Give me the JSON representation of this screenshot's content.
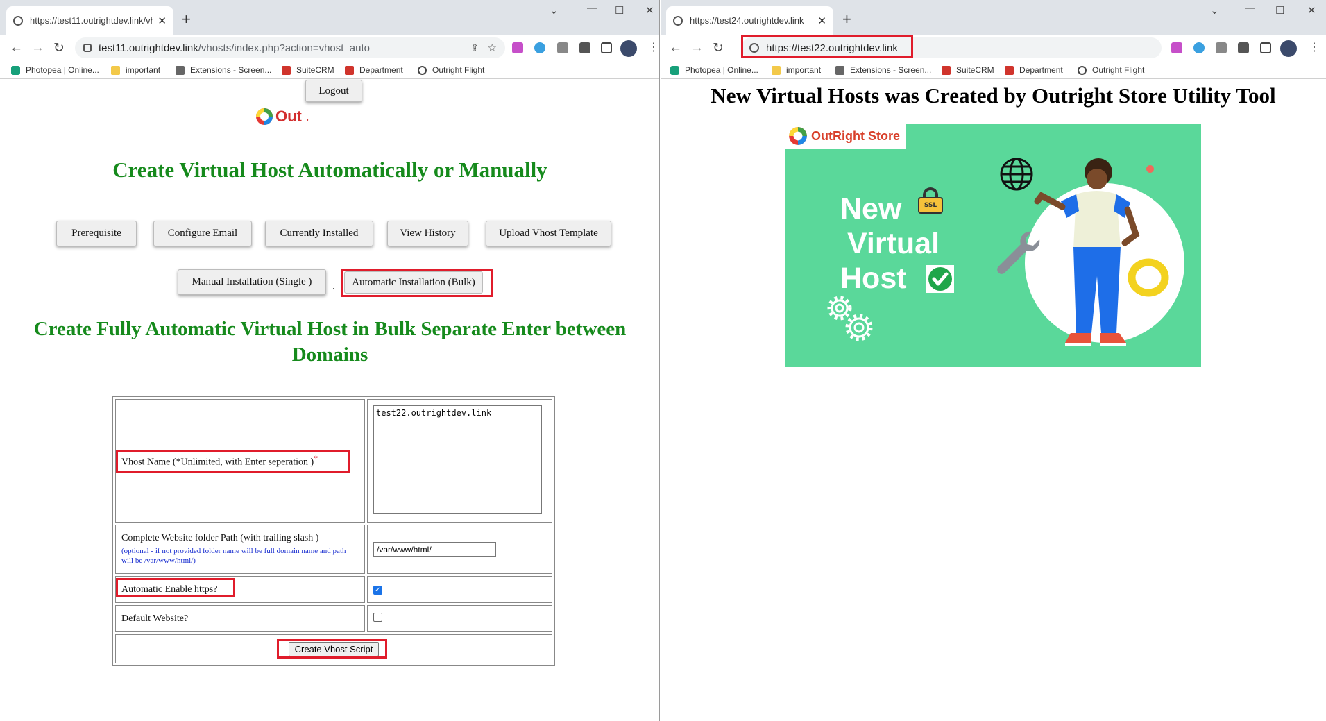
{
  "left": {
    "tab_title": "https://test11.outrightdev.link/vh",
    "url_host": "test11.outrightdev.link",
    "url_path": "/vhosts/index.php?action=vhost_auto",
    "logout": "Logout",
    "logo_text": "Out",
    "logo_dot": ".",
    "heading": "Create Virtual Host Automatically or Manually",
    "nav_buttons": [
      "Prerequisite",
      "Configure Email",
      "Currently Installed",
      "View History",
      "Upload Vhost Template"
    ],
    "manual_button": "Manual Installation (Single )",
    "sep_dot": ".",
    "auto_button": "Automatic Installation (Bulk)",
    "subheading": "Create Fully Automatic Virtual Host in Bulk Separate Enter between Domains",
    "form": {
      "vhost_label": "Vhost Name (*Unlimited, with Enter seperation )",
      "required_mark": "*",
      "vhost_value": "test22.outrightdev.link",
      "path_label": "Complete Website folder Path (with trailing slash )",
      "path_hint": "(optional - if not provided folder name will be full domain name and path will be /var/www/html/)",
      "path_value": "/var/www/html/",
      "https_label": "Automatic Enable https?",
      "https_checked": true,
      "default_label": "Default Website?",
      "default_checked": false,
      "submit": "Create Vhost Script"
    }
  },
  "right": {
    "tab_title": "https://test24.outrightdev.link",
    "url": "https://test22.outrightdev.link",
    "heading": "New Virtual Hosts was Created by Outright Store Utility Tool",
    "banner": {
      "brand": "OutRight Store",
      "line1": "New",
      "line2": "Virtual",
      "line3": "Host",
      "ssl": "SSL",
      "bg_color": "#5ad89a"
    }
  },
  "bookmarks": [
    "Photopea | Online...",
    "important",
    "Extensions - Screen...",
    "SuiteCRM",
    "Department",
    "Outright Flight"
  ],
  "new_tab_symbol": "+",
  "close_symbol": "✕"
}
